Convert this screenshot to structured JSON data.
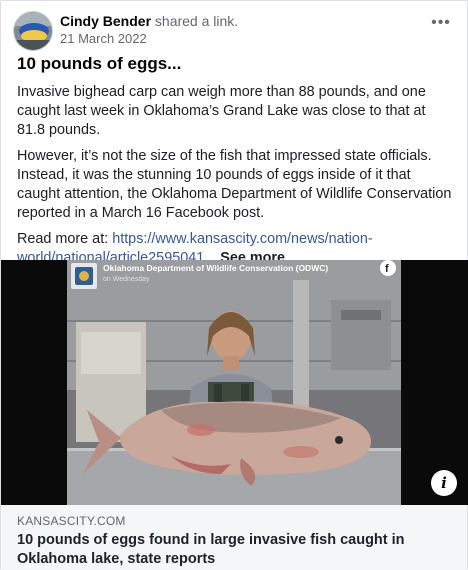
{
  "post": {
    "author": "Cindy Bender",
    "action": "shared a link.",
    "date": "21 March 2022",
    "more_icon": "•••",
    "title": "10 pounds of eggs...",
    "paragraphs": [
      "Invasive bighead carp can weigh more than 88 pounds, and one caught last week in Oklahoma’s Grand Lake was close to that at 81.8 pounds.",
      "However, it’s not the size of the fish that impressed state officials. Instead, it was the stunning 10 pounds of eggs inside of it that caught attention, the Oklahoma Department of Wildlife Conservation reported in a March 16 Facebook post."
    ],
    "read_more_label": "Read more at: ",
    "read_more_url": "https://www.kansascity.com/news/nation-world/national/article2595041",
    "ellipsis": "...",
    "see_more": "See more"
  },
  "image": {
    "overlay_org": "Oklahoma Department of Wildlife Conservation (ODWC)",
    "overlay_sub": "on Wednesday",
    "facebook_glyph": "f",
    "info_glyph": "i"
  },
  "link_preview": {
    "domain": "KANSASCITY.COM",
    "title": "10 pounds of eggs found in large invasive fish caught in Oklahoma lake, state reports"
  },
  "colors": {
    "link": "#385898",
    "secondary_text": "#65676b",
    "footer_bg": "#f5f6f7"
  }
}
